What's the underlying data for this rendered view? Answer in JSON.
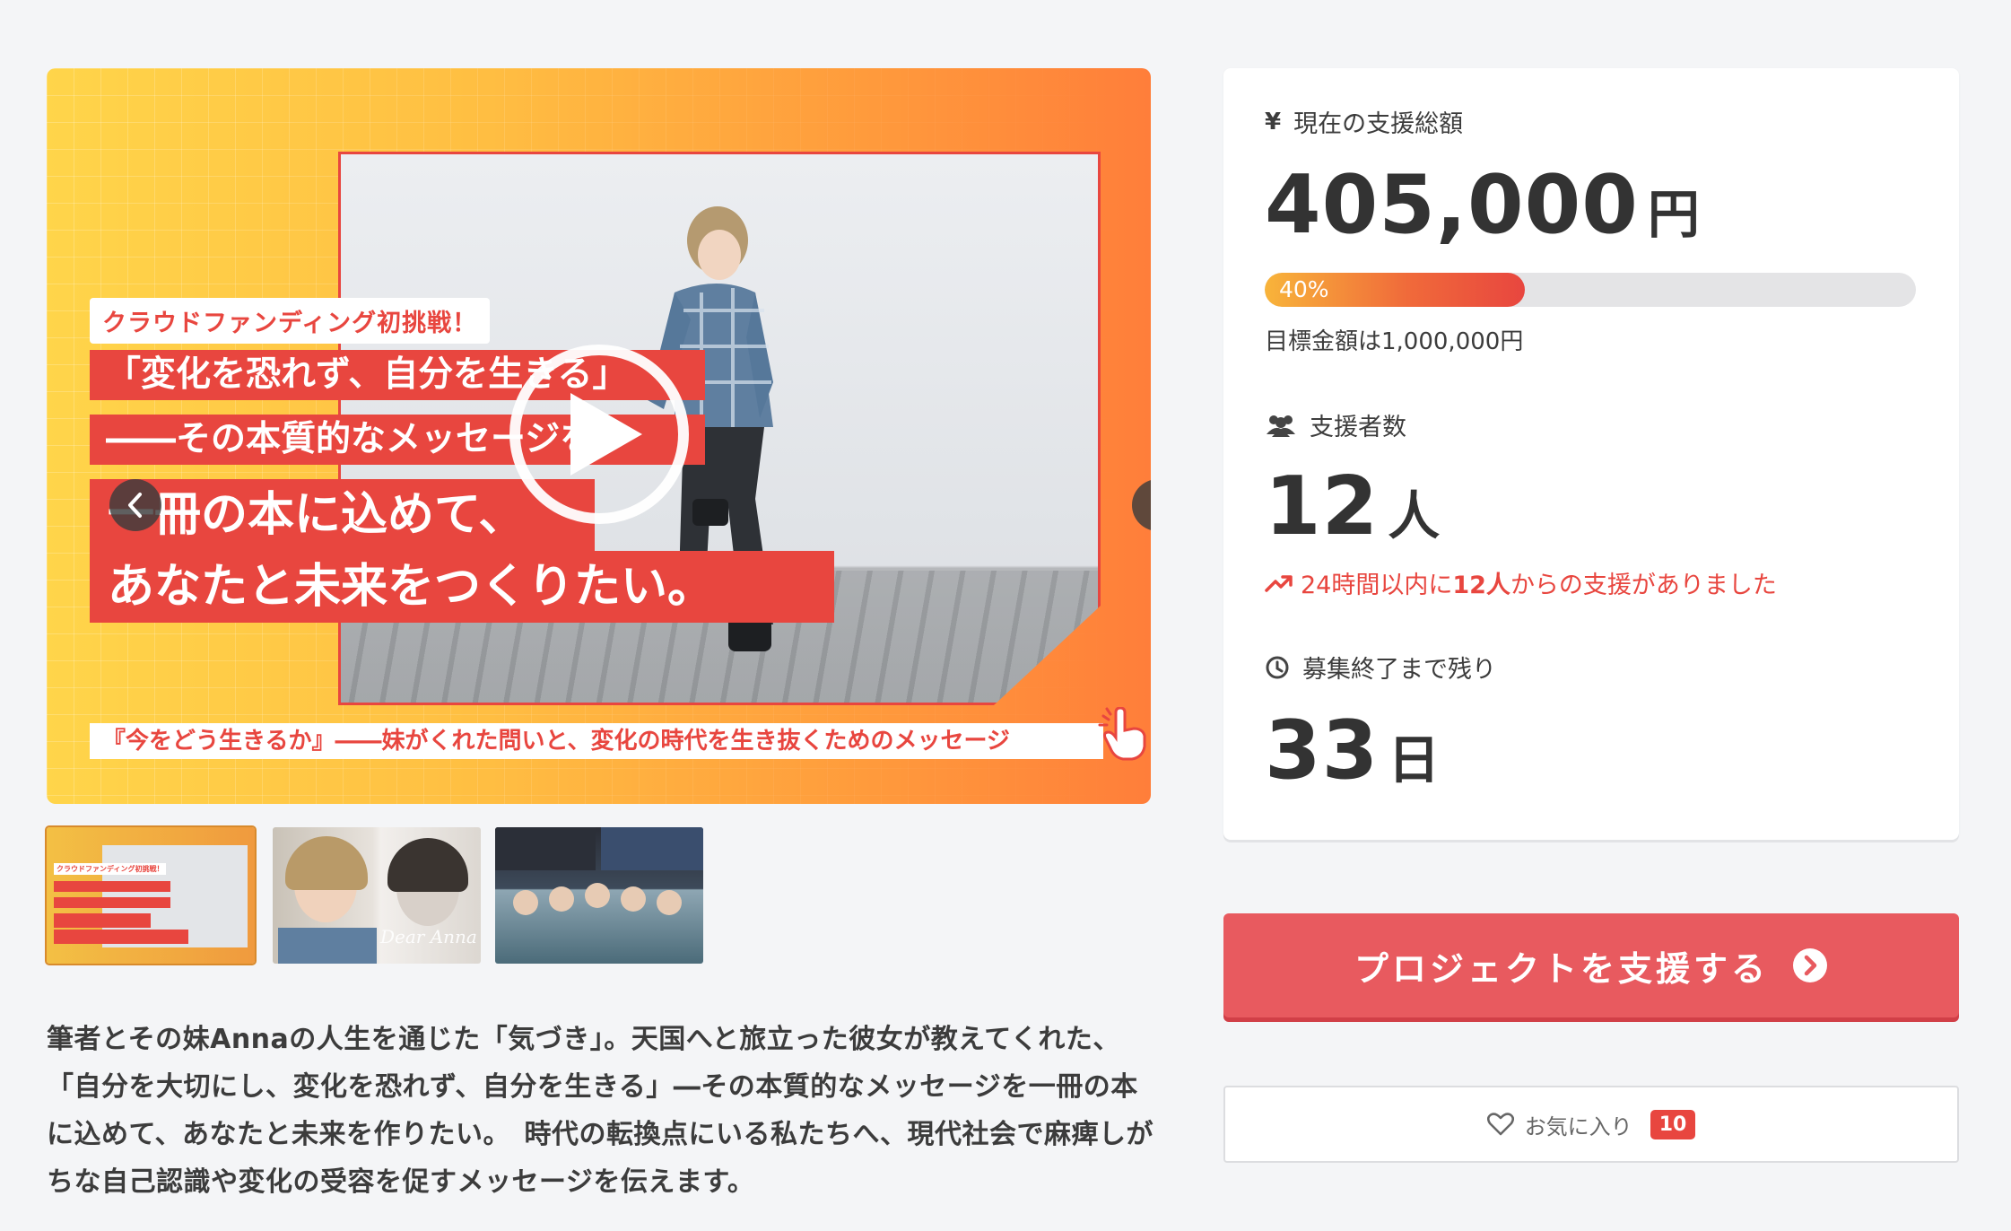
{
  "hero": {
    "tagline": "クラウドファンディング初挑戦！",
    "line1": "「変化を恐れず、自分を生きる」",
    "line2": "――その本質的なメッセージを、",
    "line3": "一冊の本に込めて、",
    "line4": "あなたと未来をつくりたい。",
    "subtitle": "『今をどう生きるか』――妹がくれた問いと、変化の時代を生き抜くためのメッセージ"
  },
  "thumbnails": {
    "t1_label": "クラウドファンディング初挑戦！",
    "t2_signature": "Dear Anna"
  },
  "description": "筆者とその妹Annaの人生を通じた「気づき」。天国へと旅立った彼女が教えてくれた、「自分を大切にし、変化を恐れず、自分を生きる」―その本質的なメッセージを一冊の本に込めて、あなたと未来を作りたい。　時代の転換点にいる私たちへ、現代社会で麻痺しがちな自己認識や変化の受容を促すメッセージを伝えます。",
  "stats": {
    "amount_label": "現在の支援総額",
    "amount_value": "405,000",
    "amount_unit": "円",
    "progress_text": "40%",
    "progress_ratio": 0.4,
    "goal_text": "目標金額は1,000,000円",
    "supporters_label": "支援者数",
    "supporters_value": "12",
    "supporters_unit": "人",
    "recent_prefix": "24時間以内に",
    "recent_count": "12人",
    "recent_suffix": "からの支援がありました",
    "remaining_label": "募集終了まで残り",
    "remaining_value": "33",
    "remaining_unit": "日"
  },
  "actions": {
    "support_label": "プロジェクトを支援する",
    "favorite_label": "お気に入り",
    "favorite_count": "10"
  },
  "colors": {
    "accent": "#e8463f",
    "button": "#e85a5f",
    "hero_start": "#ffd54a",
    "hero_end": "#ff7e3a"
  }
}
